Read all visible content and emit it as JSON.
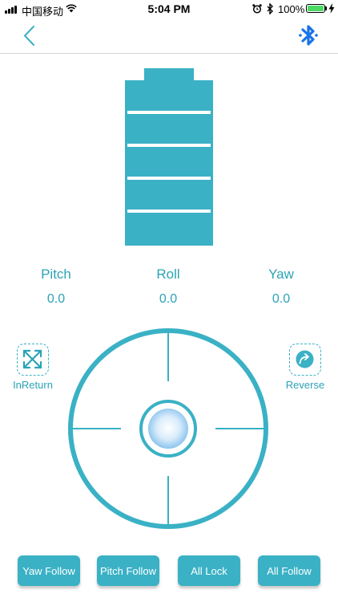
{
  "status_bar": {
    "carrier": "中国移动",
    "time": "5:04 PM",
    "battery_percent": "100%"
  },
  "nav": {
    "back_icon": "chevron-left-icon",
    "bluetooth_icon": "bluetooth-icon"
  },
  "battery_level": {
    "bars": 5,
    "color": "#3ab1c5"
  },
  "attitude": {
    "pitch": {
      "label": "Pitch",
      "value": "0.0"
    },
    "roll": {
      "label": "Roll",
      "value": "0.0"
    },
    "yaw": {
      "label": "Yaw",
      "value": "0.0"
    }
  },
  "side_controls": {
    "left": {
      "label": "InReturn",
      "icon": "expand-arrows-icon"
    },
    "right": {
      "label": "Reverse",
      "icon": "reverse-arrow-icon"
    }
  },
  "joystick": {
    "ring_color": "#3ab1c5",
    "knob_icon": "joystick-knob"
  },
  "modes": [
    {
      "label": "Yaw Follow"
    },
    {
      "label": "Pitch Follow"
    },
    {
      "label": "All Lock"
    },
    {
      "label": "All Follow"
    }
  ],
  "colors": {
    "accent": "#3ab1c5",
    "text_accent": "#2ba3b6",
    "bluetooth": "#1a73e8"
  }
}
